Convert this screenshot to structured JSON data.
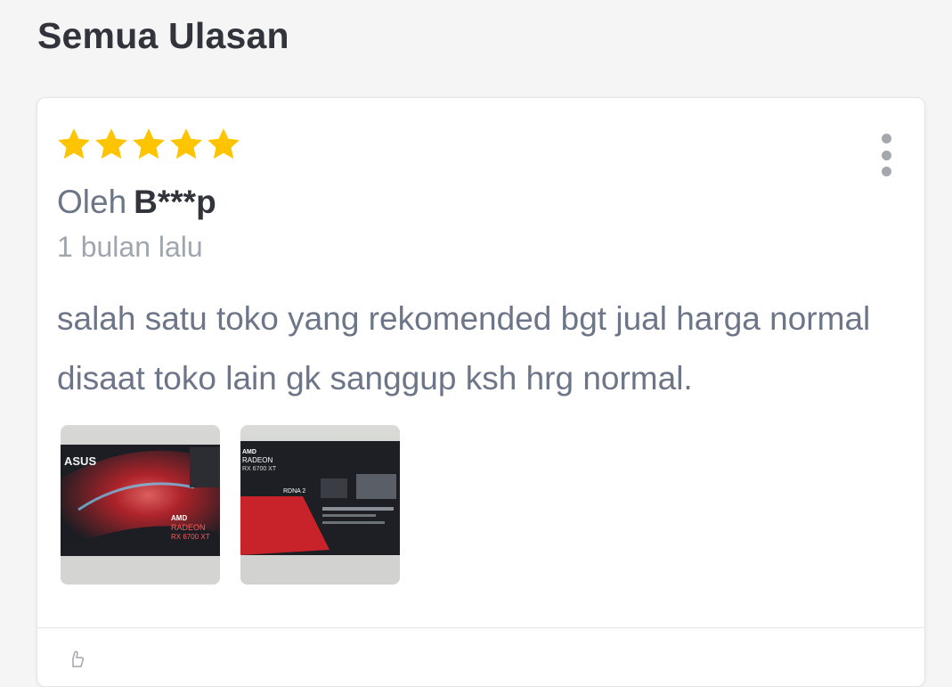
{
  "page": {
    "title": "Semua Ulasan"
  },
  "review": {
    "rating": 5,
    "rating_max": 5,
    "star_color": "#ffc400",
    "by_label": "Oleh",
    "reviewer_name": "B***p",
    "time_ago": "1 bulan lalu",
    "text": "salah satu toko yang rekomended bgt jual harga normal disaat toko lain gk sanggup ksh hrg normal.",
    "menu_icon": "more-vertical-icon",
    "photos": [
      {
        "brand": "ASUS",
        "line1": "AMD",
        "line2": "RADEON",
        "line3": "RX 6700 XT"
      },
      {
        "line1": "AMD",
        "line2": "RADEON",
        "line3": "RX 6700 XT",
        "line4": "RDNA 2"
      }
    ]
  }
}
